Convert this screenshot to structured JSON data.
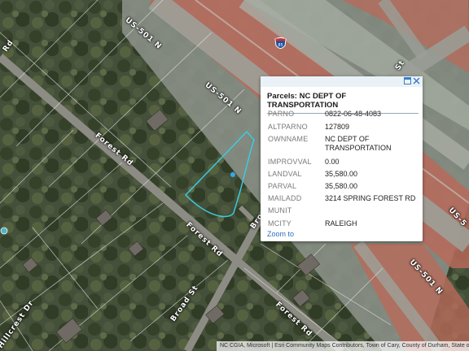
{
  "map": {
    "labels": {
      "us501_top": "US-501 N",
      "us501_mid": "US-501 N",
      "us501_right_lower": "US-501 N",
      "us501_right_edge": "US-5",
      "forest_rd_left": "Forest Rd",
      "forest_rd_mid": "Forest Rd",
      "forest_rd_lower": "Forest Rd",
      "broad_st": "Broad St",
      "broad_st_partial": "Broa",
      "right_st_partial": "St",
      "left_edge_road": "Rd",
      "left_corner_road": "Hillcrest Dr",
      "interstate_shield": "85"
    },
    "attribution": "NC CGIA, Microsoft | Esri Community Maps Contributors, Town of Cary, County of Durham, State of North Carolina",
    "colors": {
      "parcel_outline": "#35d0e8",
      "parcel_dot": "#35a8e8",
      "highway_band": "#b86a5a",
      "popup_accent": "#3a7fc6"
    }
  },
  "popup": {
    "title": "Parcels: NC DEPT OF TRANSPORTATION",
    "buttons": {
      "dock": "dock-icon",
      "close": "close-icon"
    },
    "fields": [
      {
        "key": "PARNO",
        "value": "0822-06-48-4083"
      },
      {
        "key": "ALTPARNO",
        "value": "127809"
      },
      {
        "key": "OWNNAME",
        "value": "NC DEPT OF TRANSPORTATION"
      },
      {
        "key": "IMPROVVAL",
        "value": "0.00"
      },
      {
        "key": "LANDVAL",
        "value": "35,580.00"
      },
      {
        "key": "PARVAL",
        "value": "35,580.00"
      },
      {
        "key": "MAILADD",
        "value": "3214 SPRING FOREST RD"
      },
      {
        "key": "MUNIT",
        "value": ""
      },
      {
        "key": "MCITY",
        "value": "RALEIGH"
      }
    ],
    "zoom_link": "Zoom to"
  }
}
